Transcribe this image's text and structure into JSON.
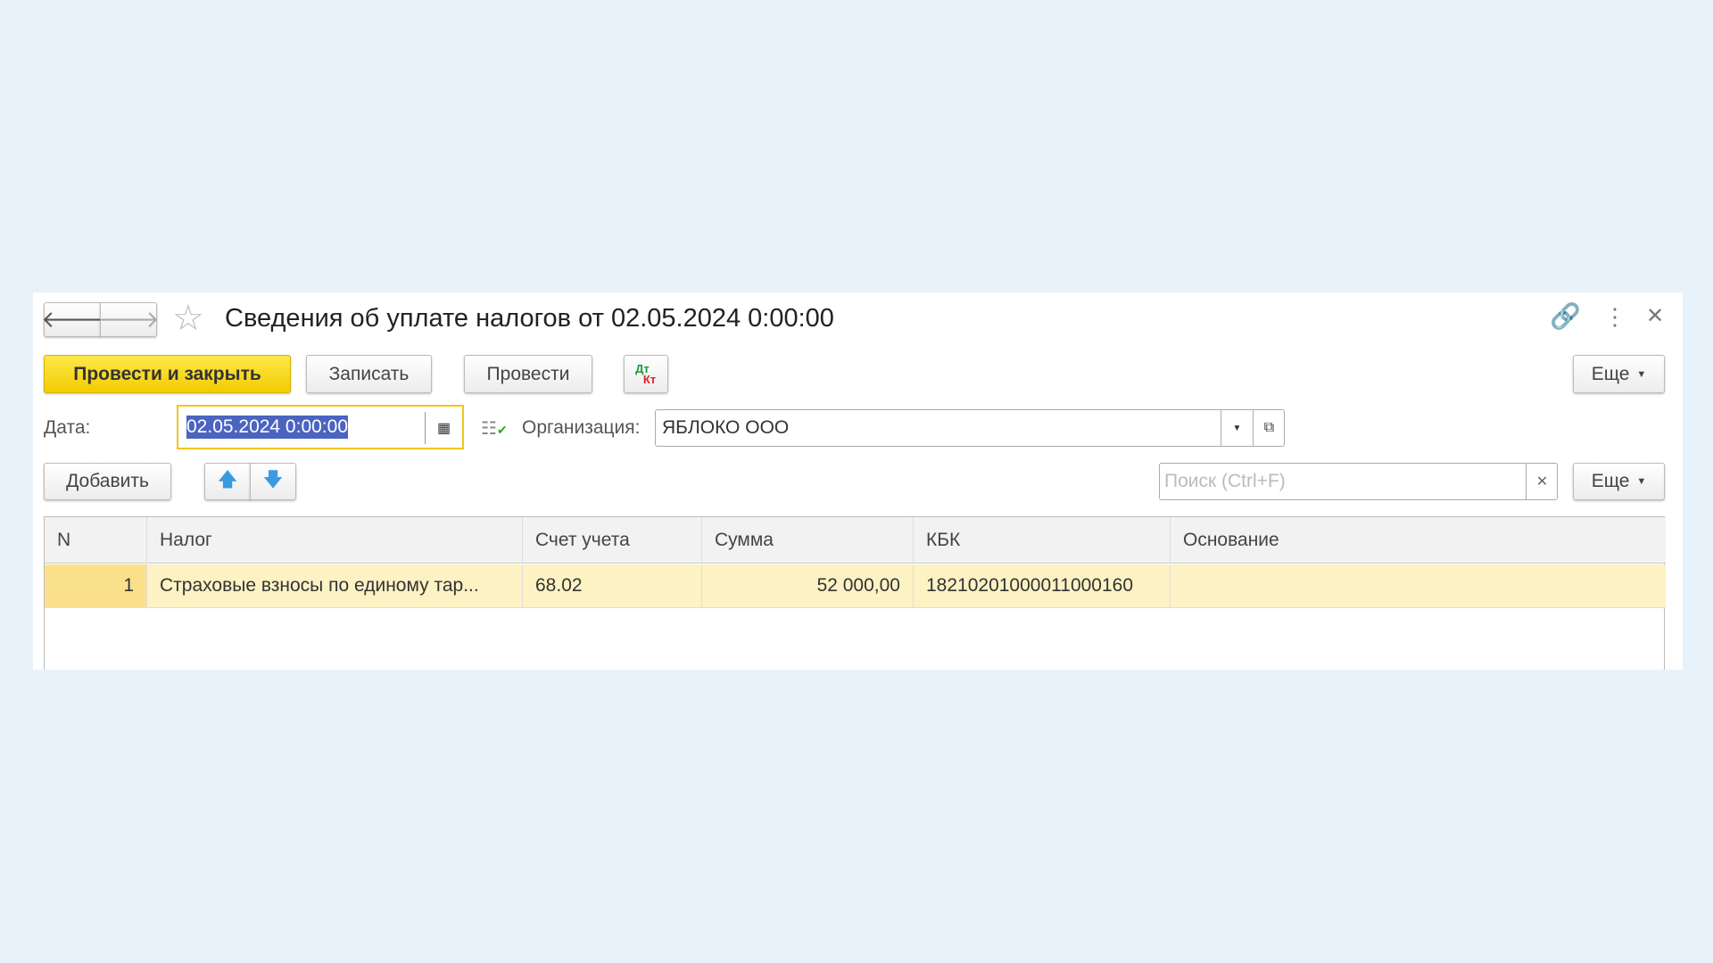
{
  "window": {
    "title": "Сведения об уплате налогов от 02.05.2024 0:00:00"
  },
  "toolbar": {
    "post_close": "Провести и закрыть",
    "save": "Записать",
    "post": "Провести",
    "dt": "Дт",
    "kt": "Кт",
    "more": "Еще"
  },
  "form": {
    "date_label": "Дата:",
    "date_value": "02.05.2024  0:00:00",
    "org_label": "Организация:",
    "org_value": "ЯБЛОКО ООО"
  },
  "table_toolbar": {
    "add": "Добавить",
    "search_placeholder": "Поиск (Ctrl+F)",
    "more": "Еще"
  },
  "table": {
    "columns": [
      "N",
      "Налог",
      "Счет учета",
      "Сумма",
      "КБК",
      "Основание"
    ],
    "rows": [
      {
        "n": "1",
        "tax": "Страховые взносы по единому тар...",
        "account": "68.02",
        "sum": "52 000,00",
        "kbk": "18210201000011000160",
        "basis": ""
      }
    ]
  },
  "colors": {
    "accent": "#f5d400",
    "focus": "#f5c518",
    "selection": "#4a64c0",
    "row_selected": "#fdf2c4"
  }
}
